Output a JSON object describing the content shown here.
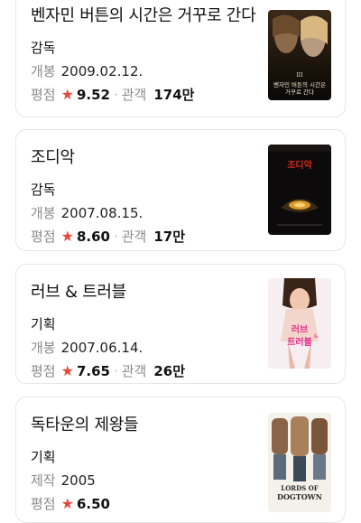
{
  "movies": [
    {
      "title": "벤자민 버튼의 시간은 거꾸로 간다",
      "role": "감독",
      "date_label": "개봉",
      "date": "2009.02.12.",
      "rating_label": "평점",
      "rating": "9.52",
      "audience_label": "관객",
      "audience": "174만",
      "poster_text": [
        "벤자민 버튼의 시간은",
        "거꾸로 간다"
      ]
    },
    {
      "title": "조디악",
      "role": "감독",
      "date_label": "개봉",
      "date": "2007.08.15.",
      "rating_label": "평점",
      "rating": "8.60",
      "audience_label": "관객",
      "audience": "17만",
      "poster_text": [
        "조디악"
      ]
    },
    {
      "title": "러브 & 트러블",
      "role": "기획",
      "date_label": "개봉",
      "date": "2007.06.14.",
      "rating_label": "평점",
      "rating": "7.65",
      "audience_label": "관객",
      "audience": "26만",
      "poster_text": [
        "러브",
        "&",
        "트러블"
      ]
    },
    {
      "title": "독타운의 제왕들",
      "role": "기획",
      "date_label": "제작",
      "date": "2005",
      "rating_label": "평점",
      "rating": "6.50",
      "poster_text": [
        "LORDS OF",
        "DOGTOWN"
      ]
    }
  ],
  "colors": {
    "star": "#e8473a",
    "label": "#8a8a8a",
    "border": "#e6e6e6"
  }
}
